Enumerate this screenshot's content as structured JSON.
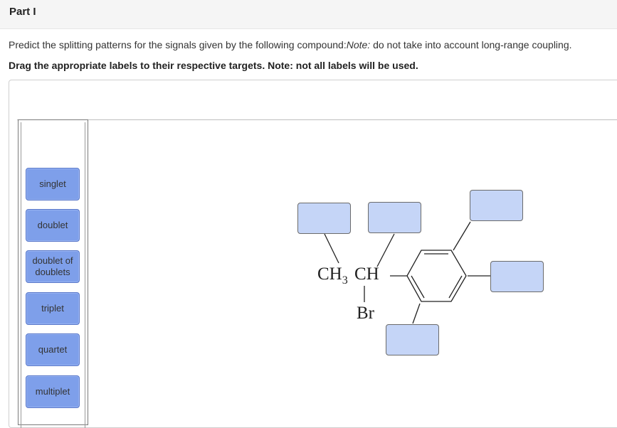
{
  "header": {
    "title": "Part I"
  },
  "instructions": {
    "text_before_note": "Predict the splitting patterns for the signals given by the following compound:",
    "note_label": "Note:",
    "note_text": " do not take into account long-range coupling.",
    "bold_text": "Drag the appropriate labels to their respective targets. Note: not all labels will be used."
  },
  "labels": [
    "singlet",
    "doublet",
    "doublet of doublets",
    "triplet",
    "quartet",
    "multiplet"
  ],
  "structure": {
    "ch3_text": "CH",
    "ch3_subscript": "3",
    "ch_text": "CH",
    "br_text": "Br"
  },
  "targets": [
    {
      "name": "target-ch3"
    },
    {
      "name": "target-ch"
    },
    {
      "name": "target-ring-ortho-upper"
    },
    {
      "name": "target-ring-para"
    },
    {
      "name": "target-ring-ortho-lower"
    }
  ],
  "colors": {
    "label_fill": "#7e9fea",
    "target_fill": "#c5d5f7",
    "header_bg": "#f5f5f5"
  }
}
